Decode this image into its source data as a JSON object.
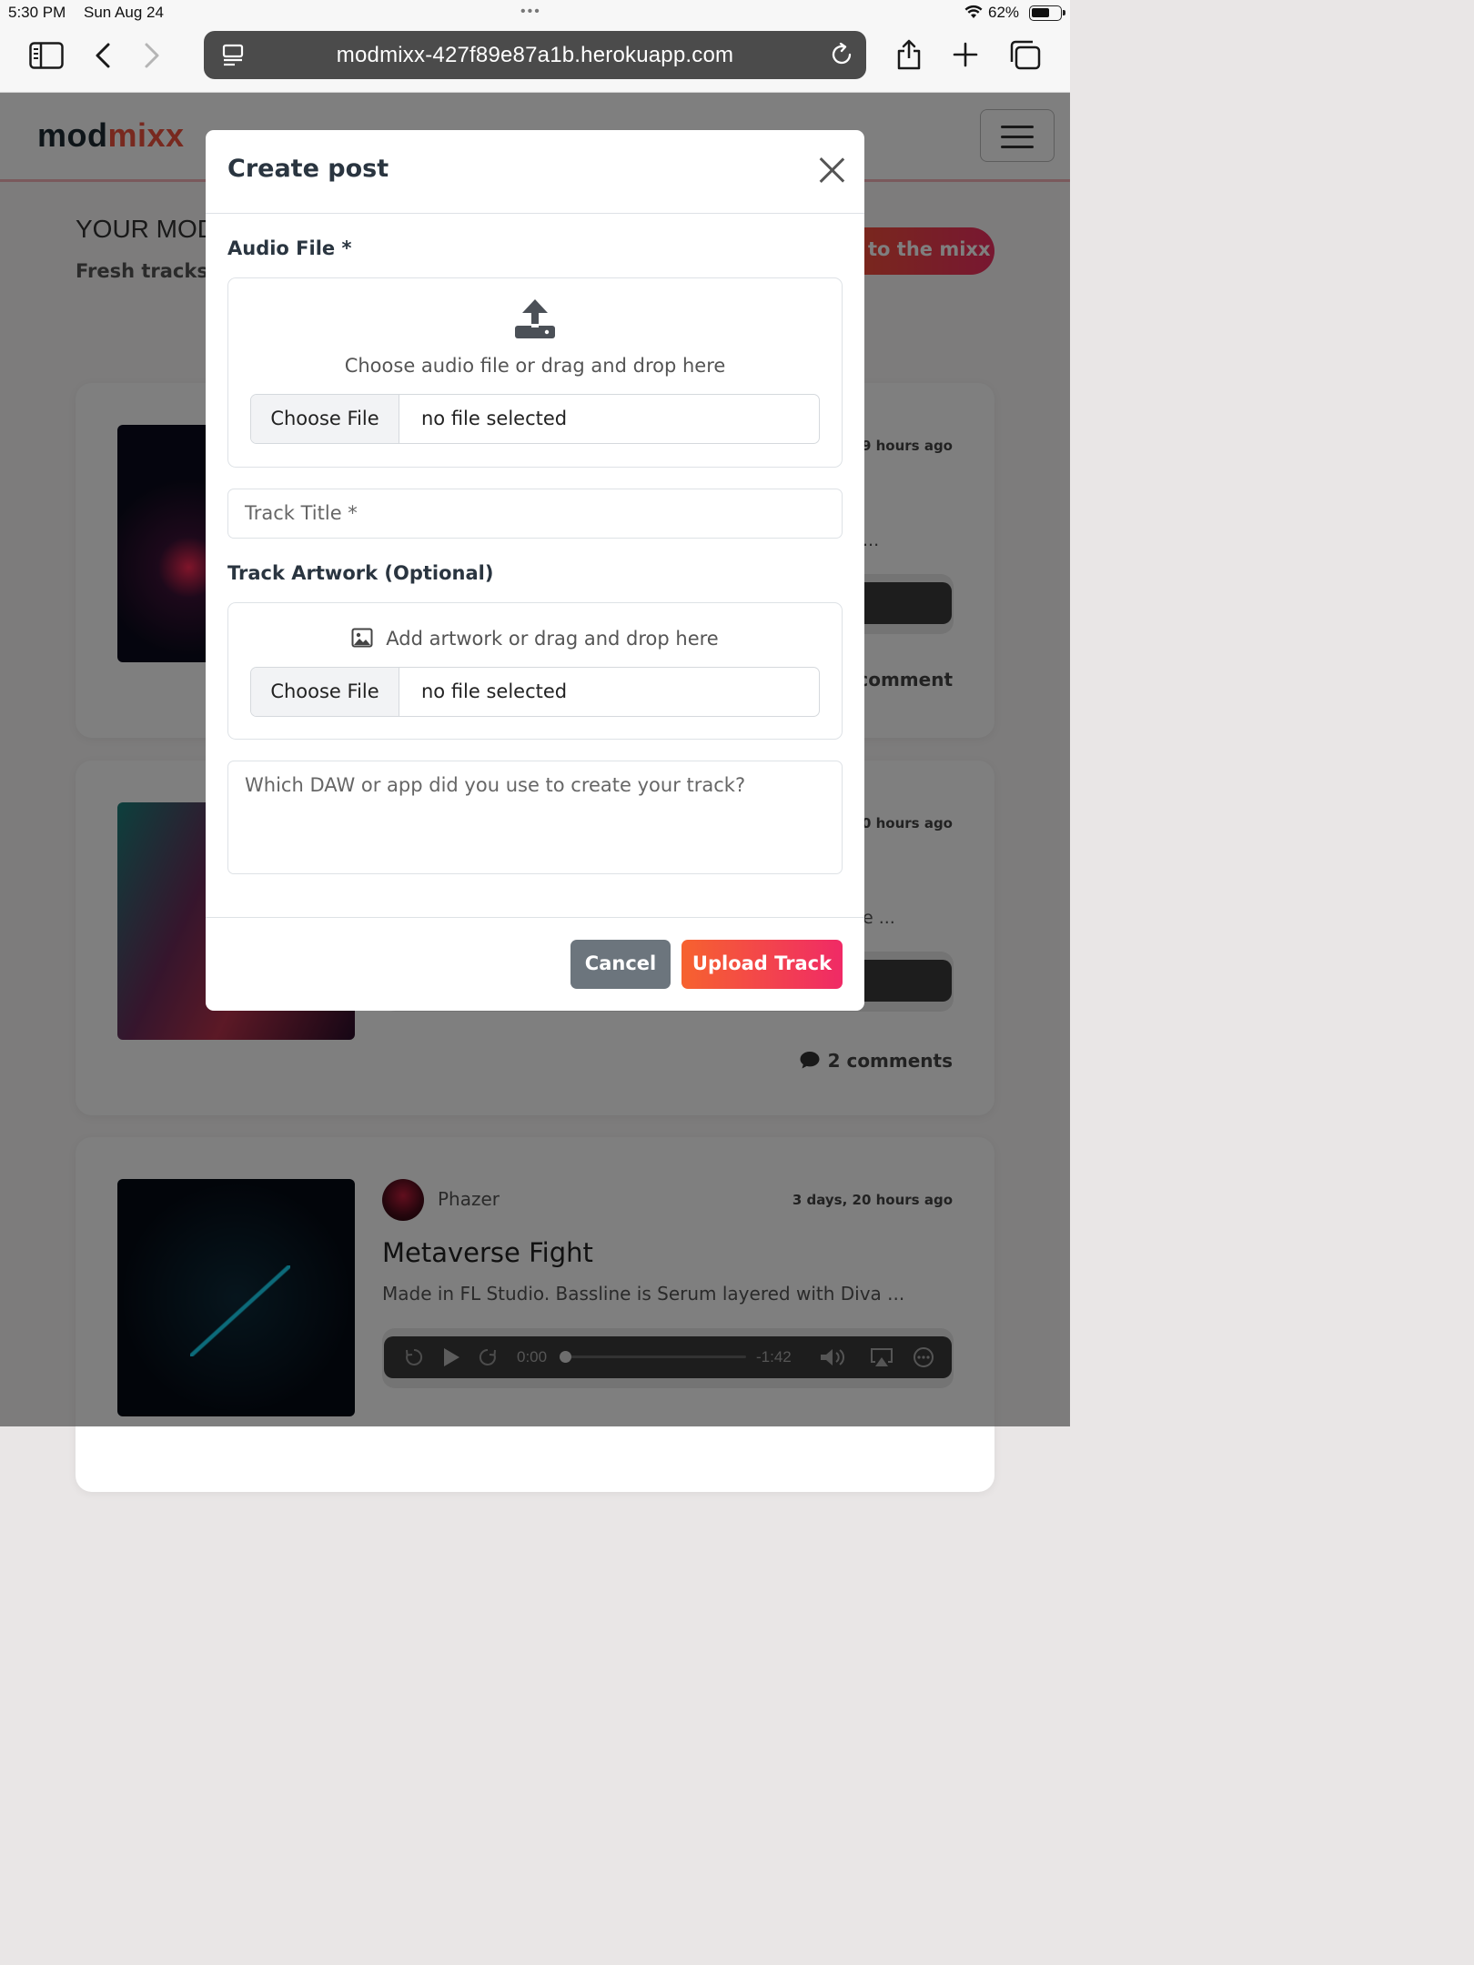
{
  "status_bar": {
    "time": "5:30 PM",
    "date": "Sun Aug 24",
    "battery": "62%"
  },
  "browser": {
    "url": "modmixx-427f89e87a1b.herokuapp.com"
  },
  "site": {
    "brand_part1": "mod",
    "brand_part2": "mixx",
    "hero_title": "YOUR MOD",
    "hero_subtitle": "Fresh tracks f",
    "cta_label": "to the mixx"
  },
  "cards": [
    {
      "time": "19 hours ago",
      "snippet": "...",
      "comments": "comment"
    },
    {
      "time": "20 hours ago",
      "snippet": "e ...",
      "comments": "2 comments"
    },
    {
      "user": "Phazer",
      "time": "3 days, 20 hours ago",
      "title": "Metaverse Fight",
      "description": "Made in FL Studio. Bassline is Serum layered with Diva ...",
      "player_current": "0:00",
      "player_remaining": "-1:42"
    }
  ],
  "modal": {
    "title": "Create post",
    "audio_label": "Audio File *",
    "audio_drop_text": "Choose audio file or drag and drop here",
    "audio_choose": "Choose File",
    "audio_file_name": "no file selected",
    "track_title_placeholder": "Track Title *",
    "artwork_label": "Track Artwork (Optional)",
    "artwork_drop_text": "Add artwork or drag and drop here",
    "artwork_choose": "Choose File",
    "artwork_file_name": "no file selected",
    "daw_placeholder": "Which DAW or app did you use to create your track?",
    "cancel_label": "Cancel",
    "upload_label": "Upload Track"
  },
  "colors": {
    "brand_dark": "#1c2a33",
    "brand_accent": "#f0533f",
    "upload_gradient_start": "#f6622f",
    "upload_gradient_end": "#f02a66",
    "cancel_gray": "#6c757d"
  }
}
